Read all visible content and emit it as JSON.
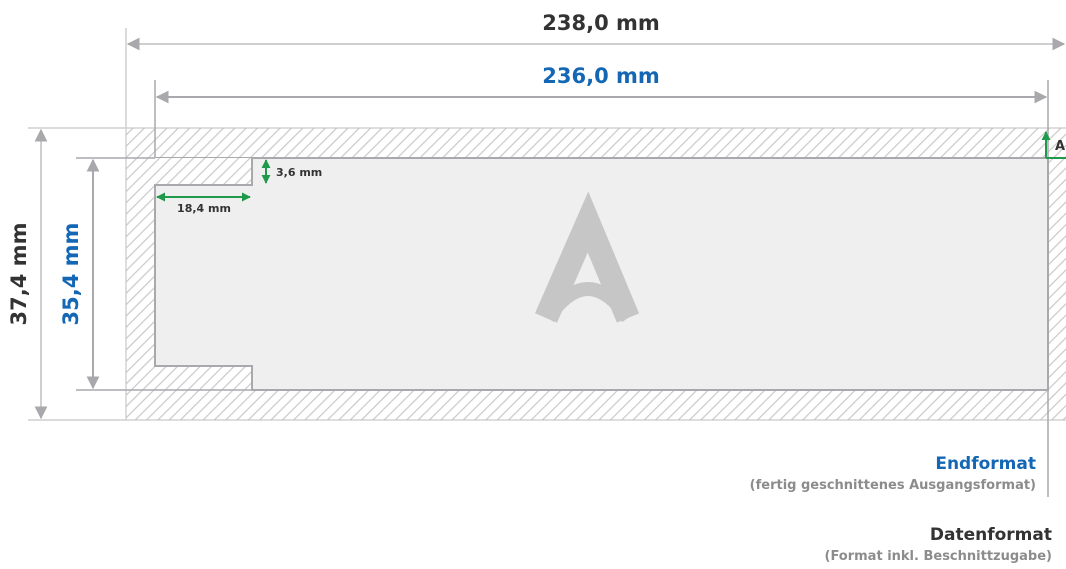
{
  "dimensions": {
    "data_width": "238,0 mm",
    "final_width": "236,0 mm",
    "data_height": "37,4 mm",
    "final_height": "35,4 mm",
    "notch_width": "18,4 mm",
    "notch_height": "3,6 mm",
    "bleed_label": "A"
  },
  "legend": {
    "final": {
      "title": "Endformat",
      "subtitle": "(fertig geschnittenes Ausgangsformat)"
    },
    "data": {
      "title": "Datenformat",
      "subtitle": "(Format inkl. Beschnittzugabe)"
    }
  },
  "colors": {
    "blue": "#1467b5",
    "green": "#1e9a4a",
    "gray_line": "#a9a9ad",
    "dark_text": "#333333"
  }
}
